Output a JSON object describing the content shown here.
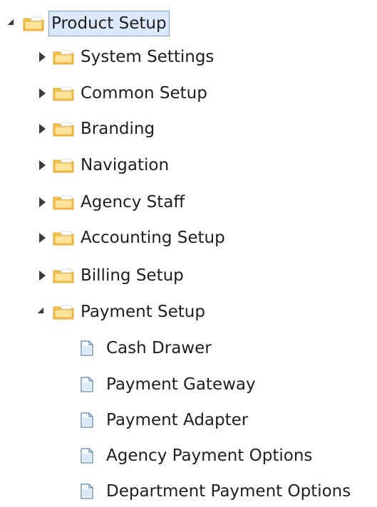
{
  "tree": {
    "root": {
      "label": "Product Setup",
      "expanded": true,
      "selected": true,
      "icon": "folder-icon"
    },
    "folders": [
      {
        "label": "System Settings",
        "expanded": false,
        "icon": "folder-icon"
      },
      {
        "label": "Common Setup",
        "expanded": false,
        "icon": "folder-icon"
      },
      {
        "label": "Branding",
        "expanded": false,
        "icon": "folder-icon"
      },
      {
        "label": "Navigation",
        "expanded": false,
        "icon": "folder-icon"
      },
      {
        "label": "Agency Staff",
        "expanded": false,
        "icon": "folder-icon"
      },
      {
        "label": "Accounting Setup",
        "expanded": false,
        "icon": "folder-icon"
      },
      {
        "label": "Billing Setup",
        "expanded": false,
        "icon": "folder-icon"
      },
      {
        "label": "Payment Setup",
        "expanded": true,
        "icon": "folder-icon"
      }
    ],
    "pages": [
      {
        "label": "Cash Drawer",
        "icon": "page-icon"
      },
      {
        "label": "Payment Gateway",
        "icon": "page-icon"
      },
      {
        "label": "Payment Adapter",
        "icon": "page-icon"
      },
      {
        "label": "Agency Payment Options",
        "icon": "page-icon"
      },
      {
        "label": "Department Payment Options",
        "icon": "page-icon"
      }
    ]
  },
  "colors": {
    "folder": "#f4c24f",
    "folder_dark": "#e1a72e",
    "selection_bg": "#dbe9fb",
    "selection_border": "#7da2ce",
    "page_stroke": "#5f88b7"
  }
}
